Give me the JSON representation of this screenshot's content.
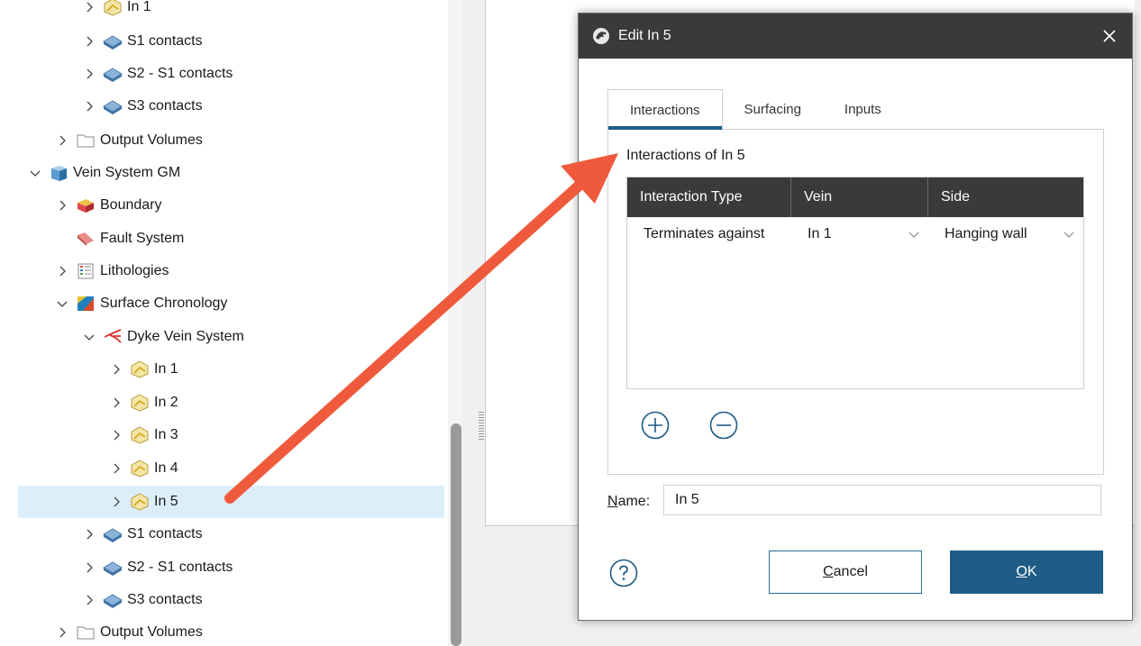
{
  "tree": {
    "items": [
      {
        "label": "In 1",
        "icon": "vein-icon",
        "expander": "right"
      },
      {
        "label": "S1 contacts",
        "icon": "contact-surface-icon",
        "expander": "right"
      },
      {
        "label": "S2 - S1 contacts",
        "icon": "contact-surface-icon",
        "expander": "right"
      },
      {
        "label": "S3 contacts",
        "icon": "contact-surface-icon",
        "expander": "right"
      },
      {
        "label": "Output Volumes",
        "icon": "folder-icon",
        "expander": "right"
      },
      {
        "label": "Vein System GM",
        "icon": "geological-model-icon",
        "expander": "down"
      },
      {
        "label": "Boundary",
        "icon": "boundary-icon",
        "expander": "right"
      },
      {
        "label": "Fault System",
        "icon": "fault-system-icon",
        "expander": "none"
      },
      {
        "label": "Lithologies",
        "icon": "lithologies-icon",
        "expander": "right"
      },
      {
        "label": "Surface Chronology",
        "icon": "surface-chronology-icon",
        "expander": "down"
      },
      {
        "label": "Dyke Vein System",
        "icon": "vein-system-icon",
        "expander": "down"
      },
      {
        "label": "In 1",
        "icon": "vein-icon",
        "expander": "right"
      },
      {
        "label": "In 2",
        "icon": "vein-icon",
        "expander": "right"
      },
      {
        "label": "In 3",
        "icon": "vein-icon",
        "expander": "right"
      },
      {
        "label": "In 4",
        "icon": "vein-icon",
        "expander": "right"
      },
      {
        "label": "In 5",
        "icon": "vein-icon",
        "expander": "right",
        "selected": true
      },
      {
        "label": "S1 contacts",
        "icon": "contact-surface-icon",
        "expander": "right"
      },
      {
        "label": "S2 - S1 contacts",
        "icon": "contact-surface-icon",
        "expander": "right"
      },
      {
        "label": "S3 contacts",
        "icon": "contact-surface-icon",
        "expander": "right"
      },
      {
        "label": "Output Volumes",
        "icon": "folder-icon",
        "expander": "right"
      }
    ]
  },
  "dialog": {
    "title": "Edit In 5",
    "title_icon": "leapfrog-icon",
    "close_icon": "close-icon",
    "tabs": [
      "Interactions",
      "Surfacing",
      "Inputs"
    ],
    "active_tab": "Interactions",
    "group_label": "Interactions of In 5",
    "table": {
      "headers": [
        "Interaction Type",
        "Vein",
        "Side"
      ],
      "rows": [
        {
          "type": "Terminates against",
          "vein": "In 1",
          "side": "Hanging wall"
        }
      ]
    },
    "name_label": "Name:",
    "name_value": "In 5",
    "cancel_label": "Cancel",
    "ok_label": "OK",
    "help_icon": "help-icon",
    "add_icon": "add-circle-icon",
    "remove_icon": "remove-circle-icon"
  },
  "colors": {
    "accent": "#1f5c86",
    "selection": "#ddeefb",
    "header_bg": "#3a3a3a",
    "annotation_arrow": "#f05a3c"
  }
}
